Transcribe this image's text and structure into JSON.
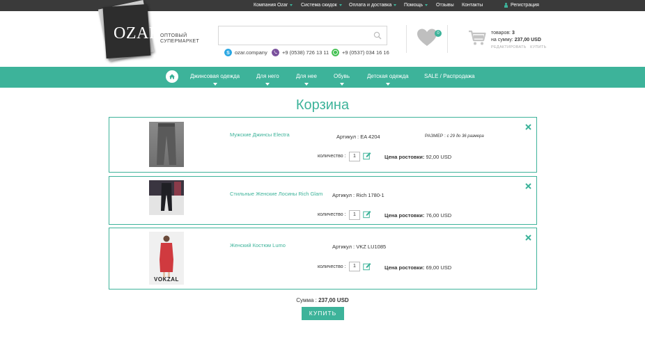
{
  "topbar": {
    "items": [
      {
        "label": "Компания Ozar",
        "dropdown": true
      },
      {
        "label": "Система скидок",
        "dropdown": true
      },
      {
        "label": "Оплата и доставка",
        "dropdown": true
      },
      {
        "label": "Помощь",
        "dropdown": true
      },
      {
        "label": "Отзывы",
        "dropdown": false
      },
      {
        "label": "Контакты",
        "dropdown": false
      }
    ],
    "register_label": "Регистрация"
  },
  "header": {
    "logo_text": "OZAR",
    "tagline_line1": "ОПТОВЫЙ",
    "tagline_line2": "СУПЕРМАРКЕТ",
    "search_placeholder": "",
    "contacts": {
      "skype": "ozar.company",
      "viber": "+9 (0538) 726 13 11",
      "whatsapp": "+9 (0537) 034 16 16"
    },
    "wishlist_count": "0",
    "cart": {
      "items_label": "товаров:",
      "items_count": "3",
      "sum_label": "на сумму:",
      "sum_value": "237,00 USD",
      "edit_label": "РЕДАКТИРОВАТЬ",
      "buy_label": "КУПИТЬ"
    }
  },
  "nav": {
    "items": [
      {
        "label": "Джинсовая одежда",
        "dropdown": true
      },
      {
        "label": "Для него",
        "dropdown": true
      },
      {
        "label": "Для нее",
        "dropdown": true
      },
      {
        "label": "Обувь",
        "dropdown": true
      },
      {
        "label": "Детская одежда",
        "dropdown": true
      },
      {
        "label": "SALE / Распродажа",
        "dropdown": false
      }
    ]
  },
  "page": {
    "title": "Корзина",
    "qty_label": "количество :",
    "price_label": "Цена ростовки:",
    "article_label": "Артикул :",
    "size_label": "РАЗМЕР :",
    "total_label": "Сумма :",
    "total_value": "237,00 USD",
    "buy_button": "КУПИТЬ"
  },
  "cart_items": [
    {
      "name": "Мужские Джинсы Electra",
      "article": "EA 4204",
      "size": "с 29 до 36 размера",
      "qty": "1",
      "price": "92,00 USD"
    },
    {
      "name": "Стильные Женские Лосины Rich Glam",
      "article": "Rich 1780-1",
      "size": "",
      "qty": "1",
      "price": "76,00 USD"
    },
    {
      "name": "Женский Костюм Lumo",
      "article": "VKZ LU1085",
      "size": "",
      "qty": "1",
      "price": "69,00 USD",
      "thumb_text": "VOKZAL"
    }
  ],
  "colors": {
    "accent": "#3db39a",
    "topbar": "#3a3a3a",
    "text": "#333333"
  }
}
